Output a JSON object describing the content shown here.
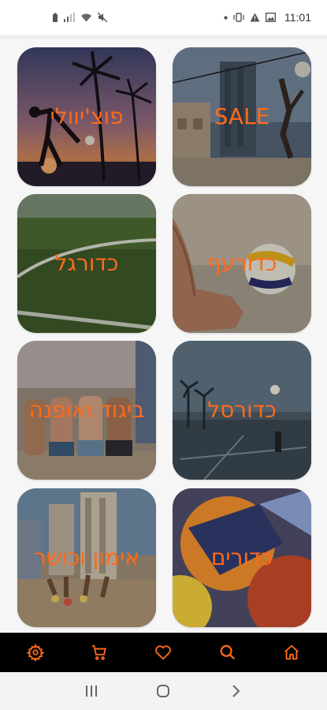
{
  "status_bar": {
    "time": "11:01",
    "left_icons": [
      "battery-icon",
      "signal-bars-icon",
      "wifi-icon",
      "mute-icon"
    ],
    "right_icons": [
      "dot-icon",
      "vibrate-icon",
      "warning-icon",
      "gallery-icon"
    ]
  },
  "categories": [
    {
      "id": "sale",
      "label": "SALE"
    },
    {
      "id": "positions",
      "label": "פוצ'יוולי"
    },
    {
      "id": "volleyball",
      "label": "כדורעף"
    },
    {
      "id": "football",
      "label": "כדורגל"
    },
    {
      "id": "basketball",
      "label": "כדורסל"
    },
    {
      "id": "apparel",
      "label": "ביגוד ואופנה"
    },
    {
      "id": "balls",
      "label": "כדורים"
    },
    {
      "id": "fitness",
      "label": "אימון וכושר"
    }
  ],
  "bottom_nav": {
    "accent_color": "#ff6a1a",
    "background": "#000000",
    "items": [
      "settings-icon",
      "cart-icon",
      "heart-icon",
      "search-icon",
      "home-icon"
    ]
  },
  "system_nav": {
    "items": [
      "recents-icon",
      "home-circle-icon",
      "back-icon"
    ]
  }
}
